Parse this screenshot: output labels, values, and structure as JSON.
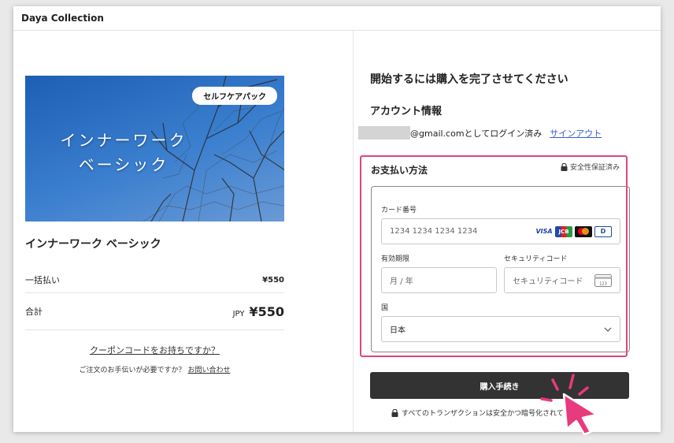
{
  "app": {
    "title": "Daya Collection"
  },
  "product": {
    "badge": "セルフケアパック",
    "hero_line1": "インナーワーク",
    "hero_line2": "ベーシック",
    "name": "インナーワーク ベーシック"
  },
  "summary": {
    "one_time_label": "一括払い",
    "one_time_price": "¥550",
    "total_label": "合計",
    "total_currency": "JPY",
    "total_price": "¥550",
    "coupon_link": "クーポンコードをお持ちですか？",
    "help_text": "ご注文のお手伝いが必要ですか？",
    "help_link": "お問い合わせ"
  },
  "checkout": {
    "heading": "開始するには購入を完了させてください",
    "account_heading": "アカウント情報",
    "login_text": "@gmail.comとしてログイン済み",
    "signout_link": "サインアウト"
  },
  "payment": {
    "title": "お支払い方法",
    "secure_badge": "安全性保証済み",
    "card_label": "カード番号",
    "card_placeholder": "1234 1234 1234 1234",
    "brands": [
      "VISA",
      "JCB",
      "Mastercard",
      "Diners Club"
    ],
    "brand_visa_text": "VISA",
    "brand_jcb_text": "JCB",
    "brand_dc_text": "D",
    "expiry_label": "有効期限",
    "expiry_placeholder": "月 / 年",
    "cvc_label": "セキュリティコード",
    "cvc_placeholder": "セキュリティコード",
    "cvc_icon_text": "123",
    "country_label": "国",
    "country_value": "日本"
  },
  "buy_button": "購入手続き",
  "footer_note": "すべてのトランザクションは安全かつ暗号化されています",
  "colors": {
    "highlight_border": "#e2457a",
    "button": "#333333",
    "link": "#3b5bd8",
    "cursor": "#e93a7d"
  }
}
